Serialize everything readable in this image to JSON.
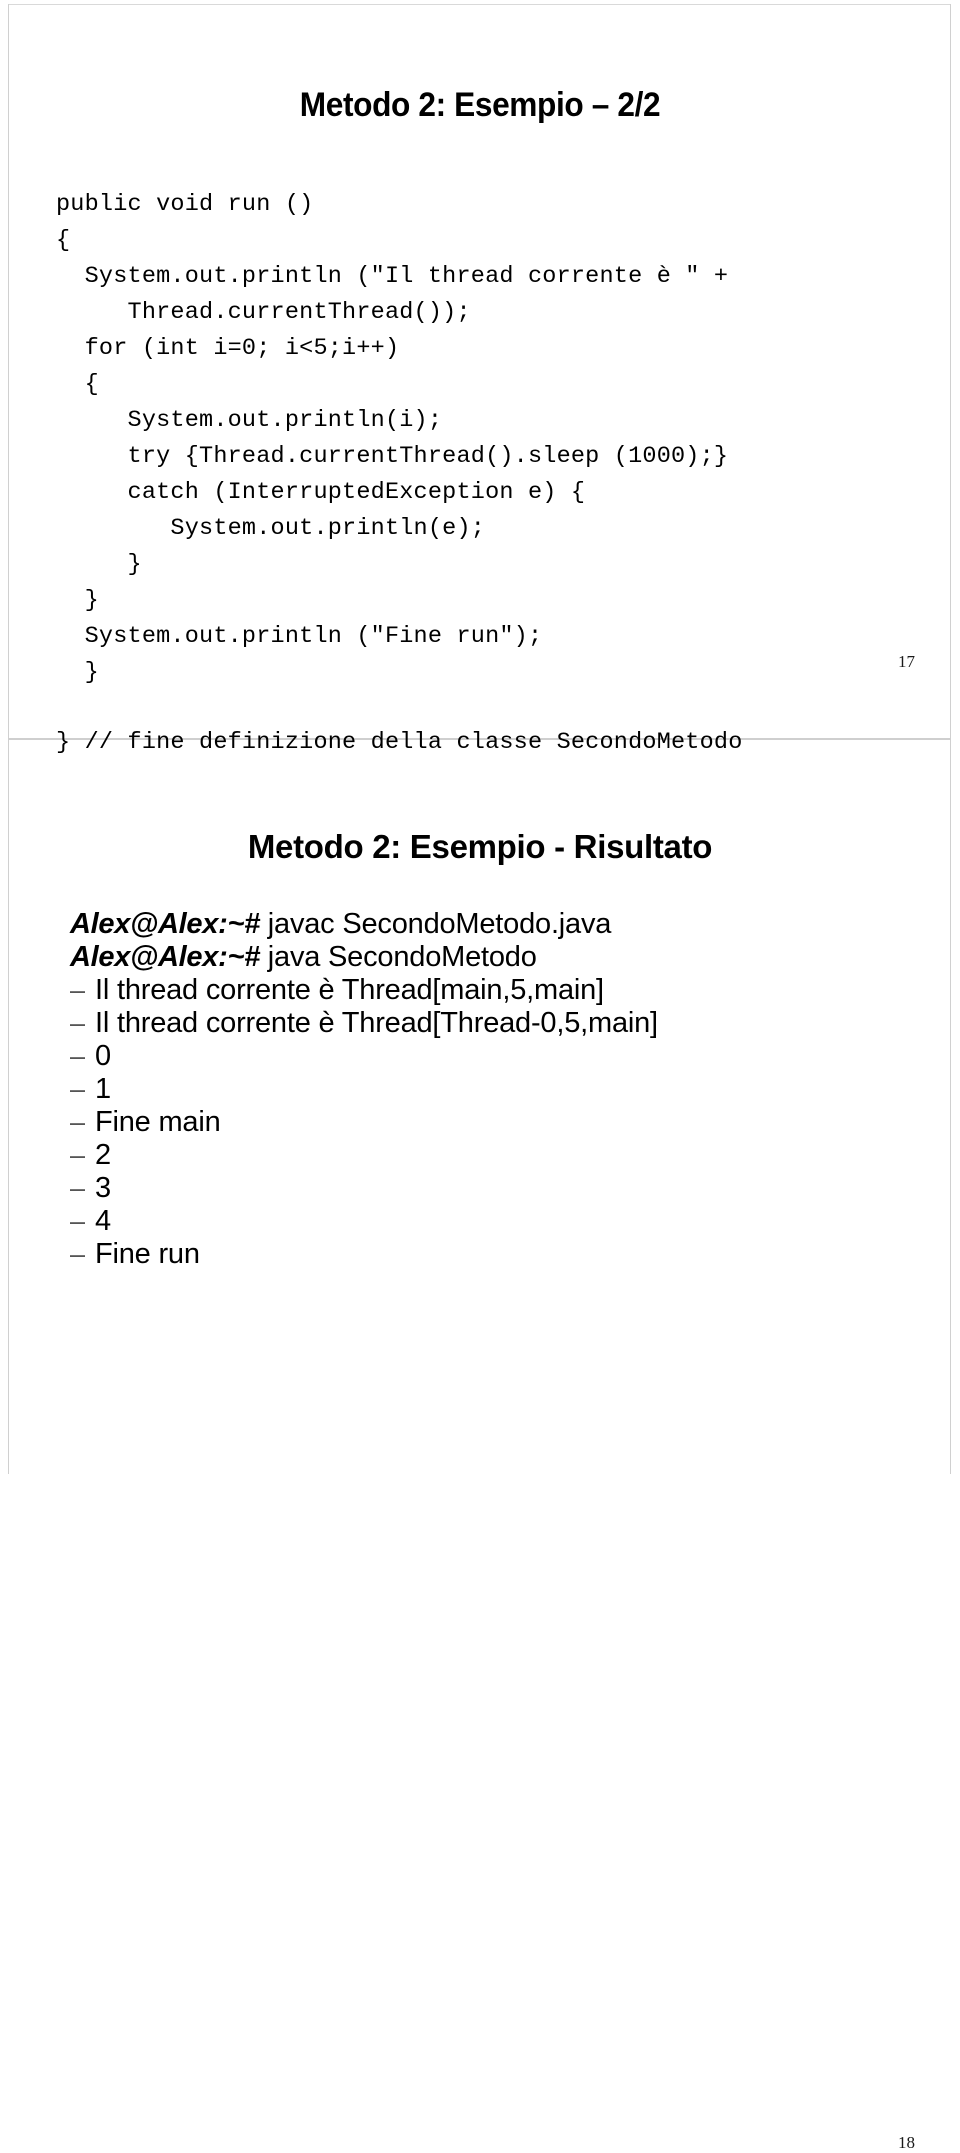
{
  "document": {
    "type": "lecture-slides-handout",
    "page_background": "#ffffff",
    "border_color": "#d0d0d0",
    "separator_color": "#cfcfcf"
  },
  "slide_one": {
    "title": "Metodo 2: Esempio – 2/2",
    "page_number": "17",
    "code_lines": [
      "public void run ()",
      "{",
      "  System.out.println (\"Il thread corrente è \" +",
      "     Thread.currentThread());",
      "  for (int i=0; i<5;i++)",
      "  {",
      "     System.out.println(i);",
      "     try {Thread.currentThread().sleep (1000);}",
      "     catch (InterruptedException e) {",
      "        System.out.println(e);",
      "     }",
      "  }",
      "  System.out.println (\"Fine run\");",
      "  }",
      "",
      "} // fine definizione della classe SecondoMetodo"
    ]
  },
  "slide_two": {
    "title": "Metodo 2: Esempio - Risultato",
    "page_number": "18",
    "terminal": {
      "commands": [
        {
          "prompt": "Alex@Alex:~#",
          "command": " javac SecondoMetodo.java"
        },
        {
          "prompt": "Alex@Alex:~#",
          "command": " java SecondoMetodo"
        }
      ],
      "bullet_marker": "–",
      "output_lines": [
        "Il thread corrente è Thread[main,5,main]",
        "Il thread corrente è Thread[Thread-0,5,main]",
        "0",
        "1",
        "Fine main",
        "2",
        "3",
        "4",
        "Fine run"
      ]
    }
  }
}
